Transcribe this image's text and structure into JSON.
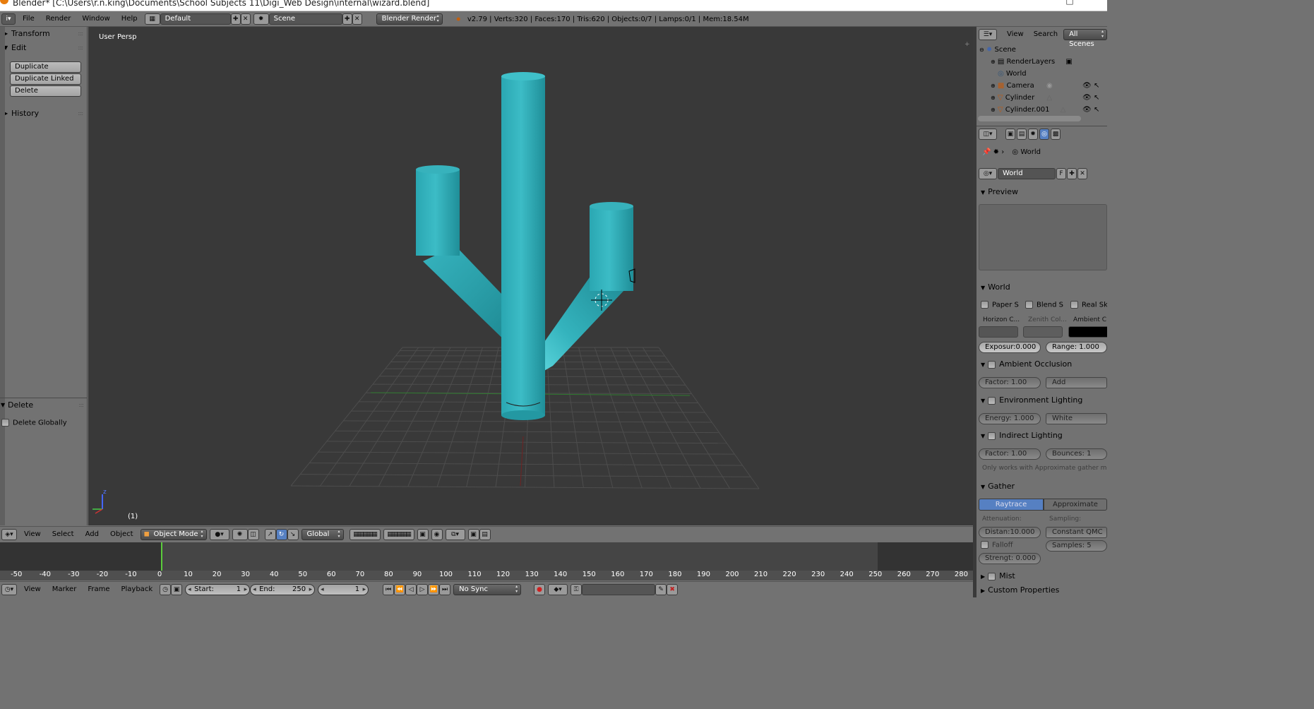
{
  "window": {
    "title": "Blender* [C:\\Users\\r.n.king\\Documents\\School Subjects 11\\Digi_Web Design\\internal\\wizard.blend]",
    "maximize_glyph": "□"
  },
  "topbar": {
    "menus": [
      "File",
      "Render",
      "Window",
      "Help"
    ],
    "screen_layout": "Default",
    "scene": "Scene",
    "render_engine": "Blender Render",
    "stats": "v2.79 | Verts:320 | Faces:170 | Tris:620 | Objects:0/7 | Lamps:0/1 | Mem:18.54M",
    "add_glyph": "✚",
    "close_glyph": "✕"
  },
  "toolshelf": {
    "transform_label": "Transform",
    "edit_label": "Edit",
    "buttons": [
      "Duplicate",
      "Duplicate Linked",
      "Delete"
    ],
    "history_label": "History",
    "operator_label": "Delete",
    "delete_globally_label": "Delete Globally",
    "collapsed_glyph": "▶",
    "expanded_glyph": "▼",
    "grip": "::::"
  },
  "viewport": {
    "view_label": "User Persp",
    "frame_label": "(1)",
    "axis_z": "z",
    "colors": {
      "cylinder_light": "#49c6cf",
      "cylinder_dark": "#1e8f99",
      "x_axis": "#6f2222",
      "y_axis": "#2f7a2f"
    }
  },
  "bottombar": {
    "menus": [
      "View",
      "Select",
      "Add",
      "Object"
    ],
    "mode": "Object Mode",
    "orientation": "Global"
  },
  "timeline": {
    "ticks": [
      -50,
      -40,
      -30,
      -20,
      -10,
      0,
      10,
      20,
      30,
      40,
      50,
      60,
      70,
      80,
      90,
      100,
      110,
      120,
      130,
      140,
      150,
      160,
      170,
      180,
      190,
      200,
      210,
      220,
      230,
      240,
      250,
      260,
      270,
      280
    ],
    "current_frame": 1
  },
  "playbar": {
    "menus": [
      "View",
      "Marker",
      "Frame",
      "Playback"
    ],
    "start_label": "Start:",
    "start_value": "1",
    "end_label": "End:",
    "end_value": "250",
    "current_value": "1",
    "sync": "No Sync",
    "transport_glyphs": [
      "⏮",
      "⏪",
      "◁",
      "▷",
      "⏩",
      "⏭"
    ]
  },
  "outliner": {
    "menus": [
      "View",
      "Search"
    ],
    "filter": "All Scenes",
    "rows": [
      {
        "label": "Scene",
        "indent": 0
      },
      {
        "label": "RenderLayers",
        "indent": 1
      },
      {
        "label": "World",
        "indent": 1
      },
      {
        "label": "Camera",
        "indent": 1
      },
      {
        "label": "Cylinder",
        "indent": 1
      },
      {
        "label": "Cylinder.001",
        "indent": 1
      }
    ]
  },
  "properties": {
    "breadcrumb": "World",
    "world_name": "World",
    "fake_user": "F",
    "preview_label": "Preview",
    "world_section": "World",
    "paper_sky": "Paper S",
    "blend_sky": "Blend S",
    "real_sky": "Real Sk",
    "horizon_label": "Horizon C...",
    "zenith_label": "Zenith Col...",
    "ambient_label": "Ambient C",
    "exposure": "Exposur:0.000",
    "range": "Range:  1.000",
    "ao_label": "Ambient Occlusion",
    "ao_factor": "Factor:    1.00",
    "ao_blend": "Add",
    "env_label": "Environment Lighting",
    "env_energy": "Energy:  1.000",
    "env_color": "White",
    "indirect_label": "Indirect Lighting",
    "indirect_factor": "Factor:    1.00",
    "indirect_bounces": "Bounces:     1",
    "indirect_note": "Only works with Approximate gather me...",
    "gather_label": "Gather",
    "raytrace": "Raytrace",
    "approximate": "Approximate",
    "attenuation_label": "Attenuation:",
    "sampling_label": "Sampling:",
    "distance": "Distan:10.000",
    "sampling_method": "Constant QMC",
    "falloff": "Falloff",
    "samples": "Samples:     5",
    "strength": "Strengt:  0.000",
    "mist_label": "Mist",
    "custom_label": "Custom Properties"
  }
}
